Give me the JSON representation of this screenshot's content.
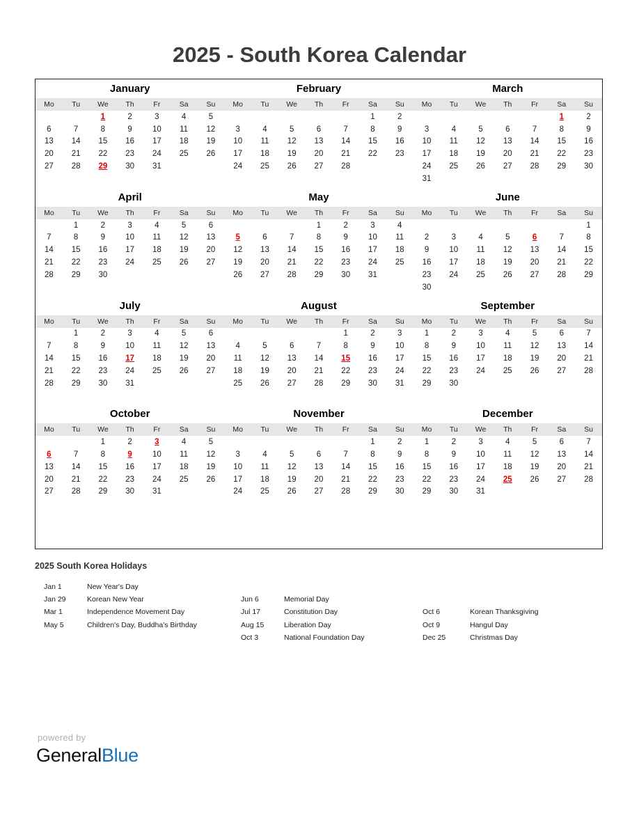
{
  "header": {
    "title": "2025 - South Korea Calendar"
  },
  "weekday_headers": [
    "Mo",
    "Tu",
    "We",
    "Th",
    "Fr",
    "Sa",
    "Su"
  ],
  "calendar": {
    "year": "2025",
    "quarters": [
      {
        "months": [
          {
            "name": "January",
            "lead_blanks": 2,
            "days": 31,
            "holidays": [
              1,
              29
            ]
          },
          {
            "name": "February",
            "lead_blanks": 5,
            "days": 28,
            "holidays": []
          },
          {
            "name": "March",
            "lead_blanks": 5,
            "days": 31,
            "holidays": [
              1
            ]
          }
        ]
      },
      {
        "months": [
          {
            "name": "April",
            "lead_blanks": 1,
            "days": 30,
            "holidays": []
          },
          {
            "name": "May",
            "lead_blanks": 3,
            "days": 31,
            "holidays": [
              5
            ]
          },
          {
            "name": "June",
            "lead_blanks": 6,
            "days": 30,
            "holidays": [
              6
            ]
          }
        ]
      },
      {
        "months": [
          {
            "name": "July",
            "lead_blanks": 1,
            "days": 31,
            "holidays": [
              17
            ]
          },
          {
            "name": "August",
            "lead_blanks": 4,
            "days": 31,
            "holidays": [
              15
            ]
          },
          {
            "name": "September",
            "lead_blanks": 0,
            "days": 30,
            "holidays": []
          }
        ]
      },
      {
        "months": [
          {
            "name": "October",
            "lead_blanks": 2,
            "days": 31,
            "holidays": [
              3,
              6,
              9
            ]
          },
          {
            "name": "November",
            "lead_blanks": 5,
            "days": 30,
            "holidays": []
          },
          {
            "name": "December",
            "lead_blanks": 0,
            "days": 31,
            "holidays": [
              25
            ]
          }
        ]
      }
    ]
  },
  "holidays_section": {
    "title": "2025 South Korea Holidays",
    "columns": [
      {
        "lead_spacers": 0,
        "items": [
          {
            "date": "Jan 1",
            "name": "New Year's Day"
          },
          {
            "date": "Jan 29",
            "name": "Korean New Year"
          },
          {
            "date": "Mar 1",
            "name": "Independence Movement Day"
          },
          {
            "date": "May 5",
            "name": "Children's Day, Buddha's Birthday"
          }
        ]
      },
      {
        "lead_spacers": 1,
        "items": [
          {
            "date": "Jun 6",
            "name": "Memorial Day"
          },
          {
            "date": "Jul 17",
            "name": "Constitution Day"
          },
          {
            "date": "Aug 15",
            "name": "Liberation Day"
          },
          {
            "date": "Oct 3",
            "name": "National Foundation Day"
          }
        ]
      },
      {
        "lead_spacers": 2,
        "items": [
          {
            "date": "Oct 6",
            "name": "Korean Thanksgiving"
          },
          {
            "date": "Oct 9",
            "name": "Hangul Day"
          },
          {
            "date": "Dec 25",
            "name": "Christmas Day"
          }
        ]
      }
    ]
  },
  "footer": {
    "powered_by": "powered by",
    "logo_part1": "General",
    "logo_part2": "Blue",
    "logo_accent_color": "#1a6fb5"
  },
  "colors": {
    "holiday_red": "#e00000",
    "weekday_band": "#e6e6e6",
    "border": "#222222",
    "title": "#3c3c3c"
  }
}
